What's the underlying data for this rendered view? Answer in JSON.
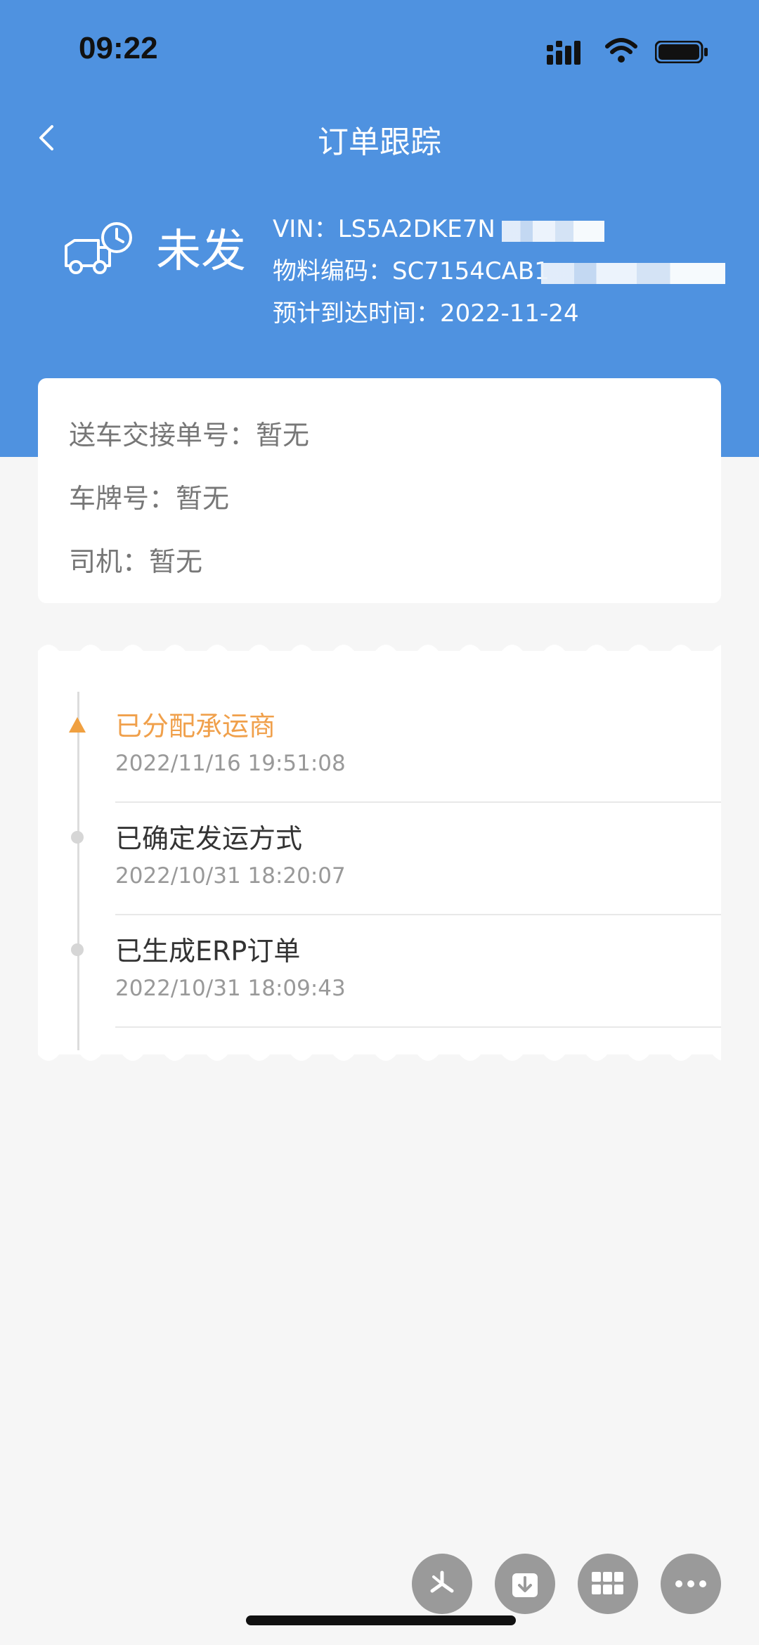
{
  "status_bar": {
    "time": "09:22"
  },
  "nav": {
    "title": "订单跟踪"
  },
  "summary": {
    "status": "未发",
    "vin_label": "VIN：",
    "vin_value": "LS5A2DKE7N",
    "material_label": "物料编码：",
    "material_value": "SC7154CAB1",
    "eta_label": "预计到达时间：",
    "eta_value": "2022-11-24"
  },
  "card": {
    "handover_label": "送车交接单号：",
    "handover_value": "暂无",
    "plate_label": "车牌号：",
    "plate_value": "暂无",
    "driver_label": "司机：",
    "driver_value": "暂无"
  },
  "timeline": [
    {
      "title": "已分配承运商",
      "time": "2022/11/16 19:51:08"
    },
    {
      "title": "已确定发运方式",
      "time": "2022/10/31 18:20:07"
    },
    {
      "title": "已生成ERP订单",
      "time": "2022/10/31 18:09:43"
    }
  ],
  "colors": {
    "header": "#4f92e0",
    "active": "#f0a04b",
    "background": "#f6f6f6"
  },
  "icons": [
    "back-icon",
    "truck-clock-icon",
    "signal-icon",
    "wifi-icon",
    "battery-icon",
    "pinwheel-icon",
    "download-icon",
    "grid-icon",
    "more-icon"
  ]
}
